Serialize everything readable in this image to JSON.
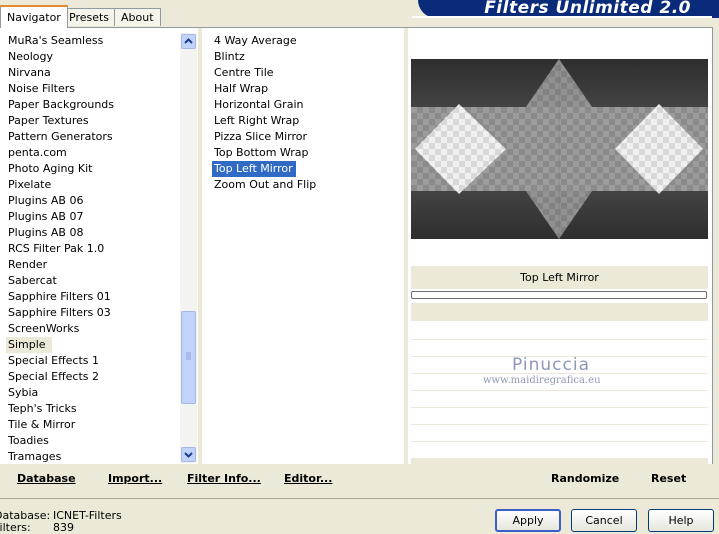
{
  "tabs": [
    "Navigator",
    "Presets",
    "About"
  ],
  "app_title": "Filters Unlimited 2.0",
  "categories": [
    "MuRa's Seamless",
    "Neology",
    "Nirvana",
    "Noise Filters",
    "Paper Backgrounds",
    "Paper Textures",
    "Pattern Generators",
    "penta.com",
    "Photo Aging Kit",
    "Pixelate",
    "Plugins AB 06",
    "Plugins AB 07",
    "Plugins AB 08",
    "RCS Filter Pak 1.0",
    "Render",
    "Sabercat",
    "Sapphire Filters 01",
    "Sapphire Filters 03",
    "ScreenWorks",
    "Simple",
    "Special Effects 1",
    "Special Effects 2",
    "Sybia",
    "Teph's Tricks",
    "Tile & Mirror",
    "Toadies",
    "Tramages"
  ],
  "selected_category": "Simple",
  "filters": [
    "4 Way Average",
    "Blintz",
    "Centre Tile",
    "Half Wrap",
    "Horizontal Grain",
    "Left Right Wrap",
    "Pizza Slice Mirror",
    "Top Bottom Wrap",
    "Top Left Mirror",
    "Zoom Out and Flip"
  ],
  "selected_filter": "Top Left Mirror",
  "preview_title": "Top Left Mirror",
  "watermark": {
    "name": "Pinuccia",
    "url": "www.maidiregrafica.eu"
  },
  "actions": {
    "database": "Database",
    "import": "Import...",
    "filter_info": "Filter Info...",
    "editor": "Editor...",
    "randomize": "Randomize",
    "reset": "Reset"
  },
  "status": {
    "database_label": "Database:",
    "database_value": "ICNET-Filters",
    "filters_label": "Filters:",
    "filters_value": "839"
  },
  "buttons": {
    "apply": "Apply",
    "cancel": "Cancel",
    "help": "Help"
  },
  "colors": {
    "selection": "#316ac5",
    "title_bar": "#0a2a7a",
    "panel": "#ece9d8"
  }
}
